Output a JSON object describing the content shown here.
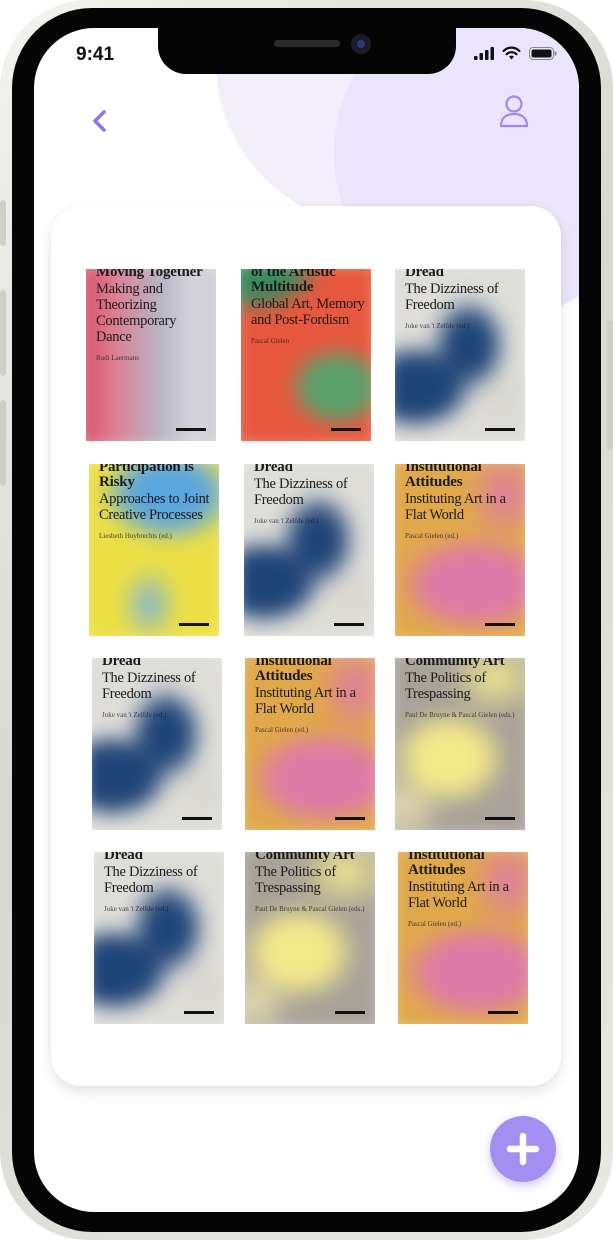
{
  "status_bar": {
    "time": "9:41"
  },
  "nav": {
    "back_icon": "chevron-left-icon",
    "profile_icon": "user-icon"
  },
  "colors": {
    "accent": "#a38ef2",
    "back_chevron": "#8b78ee",
    "profile_icon": "#9c8af0"
  },
  "books": [
    {
      "title": "Moving Together",
      "subtitle": "Making and Theorizing Contemporary Dance",
      "author": "Rudi Laermans"
    },
    {
      "title": "of the Artistic Multitude",
      "subtitle": "Global Art, Memory and Post-Fordism",
      "author": "Pascal Gielen"
    },
    {
      "title": "Dread",
      "subtitle": "The Dizziness of Freedom",
      "author": "Joke van 't Zelfde (ed.)"
    },
    {
      "title": "Participation is Risky",
      "subtitle": "Approaches to Joint Creative Processes",
      "author": "Liesbeth Huybrechts (ed.)"
    },
    {
      "title": "Dread",
      "subtitle": "The Dizziness of Freedom",
      "author": "Joke van 't Zelfde (ed.)"
    },
    {
      "title": "Institutional Attitudes",
      "subtitle": "Instituting Art in a Flat World",
      "author": "Pascal Gielen (ed.)"
    },
    {
      "title": "Dread",
      "subtitle": "The Dizziness of Freedom",
      "author": "Joke van 't Zelfde (ed.)"
    },
    {
      "title": "Institutional Attitudes",
      "subtitle": "Instituting Art in a Flat World",
      "author": "Pascal Gielen (ed.)"
    },
    {
      "title": "Community Art",
      "subtitle": "The Politics of Trespassing",
      "author": "Paul De Bruyne & Pascal Gielen (eds.)"
    },
    {
      "title": "Dread",
      "subtitle": "The Dizziness of Freedom",
      "author": "Joke van 't Zelfde (ed.)"
    },
    {
      "title": "Community Art",
      "subtitle": "The Politics of Trespassing",
      "author": "Paul De Bruyne & Pascal Gielen (eds.)"
    },
    {
      "title": "Institutional Attitudes",
      "subtitle": "Instituting Art in a Flat World",
      "author": "Pascal Gielen (ed.)"
    }
  ],
  "fab": {
    "icon": "plus-icon"
  }
}
